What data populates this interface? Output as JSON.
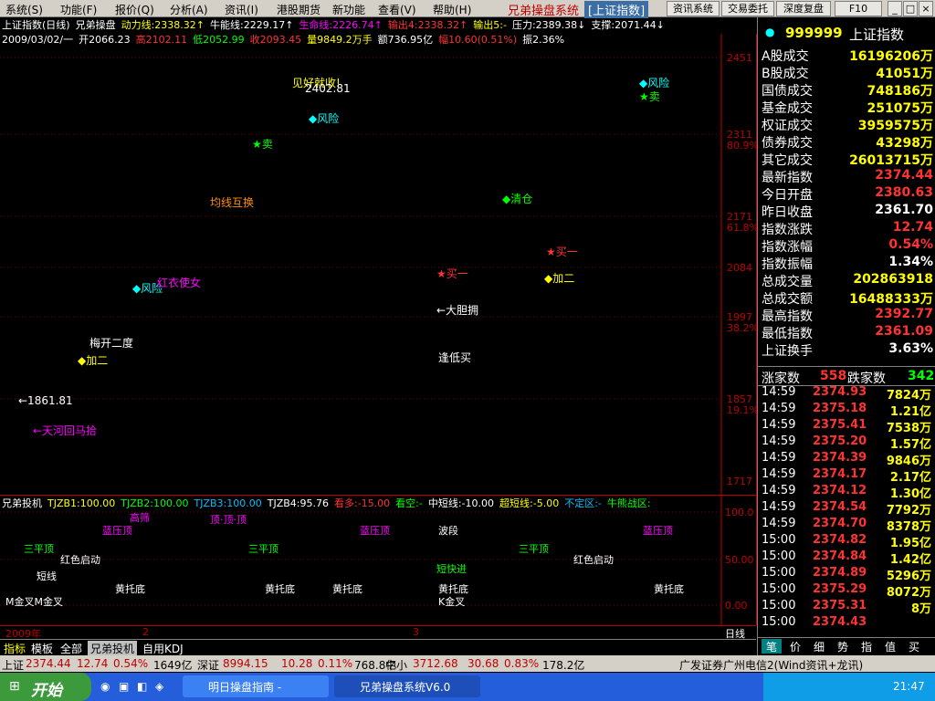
{
  "menu": {
    "items": [
      "系统(S)",
      "功能(F)",
      "报价(Q)",
      "分析(A)",
      "资讯(I)",
      "港股期货",
      "新功能",
      "查看(V)",
      "帮助(H)"
    ],
    "app_title": "兄弟操盘系统",
    "app_subtitle": "[上证指数]",
    "buttons": [
      "资讯系统",
      "交易委托",
      "深度复盘",
      "F10"
    ]
  },
  "chart_header": {
    "line1": [
      {
        "text": "上证指数(日线)",
        "color": "#ffffff"
      },
      {
        "text": "兄弟操盘",
        "color": "#ffffff"
      },
      {
        "text": "动力线:2338.32↑",
        "color": "#ffff00"
      },
      {
        "text": "牛能线:2229.17↑",
        "color": "#ffffff"
      },
      {
        "text": "生命线:2226.74↑",
        "color": "#ff00ff"
      },
      {
        "text": "输出4:2338.32↑",
        "color": "#ff3333"
      },
      {
        "text": "输出5:-",
        "color": "#ffff00"
      },
      {
        "text": "压力:2389.38↓",
        "color": "#ffffff"
      },
      {
        "text": "支撑:2071.44↓",
        "color": "#ffffff"
      }
    ],
    "line2": [
      {
        "text": "2009/03/02/一",
        "color": "#ffffff"
      },
      {
        "text": "开2066.23",
        "color": "#ffffff"
      },
      {
        "text": "高2102.11",
        "color": "#ff3333"
      },
      {
        "text": "低2052.99",
        "color": "#00ff00"
      },
      {
        "text": "收2093.45",
        "color": "#ff3333"
      },
      {
        "text": "量9849.2万手",
        "color": "#ffff00"
      },
      {
        "text": "额736.95亿",
        "color": "#ffffff"
      },
      {
        "text": "幅10.60(0.51%)",
        "color": "#ff3333"
      },
      {
        "text": "振2.36%",
        "color": "#ffffff"
      }
    ]
  },
  "price_axis": [
    "2451",
    "2311",
    "80.9%",
    "2171",
    "61.8%",
    "2084",
    "1997",
    "38.2%",
    "1857",
    "19.1%",
    "1717"
  ],
  "chart_annotations": [
    {
      "text": "见好就收!",
      "color": "#ffff00"
    },
    {
      "text": "2402.81",
      "color": "#ffffff"
    },
    {
      "text": "◆风险",
      "color": "#00ffff"
    },
    {
      "text": "★卖",
      "color": "#00ff00"
    },
    {
      "text": "均线互换",
      "color": "#ff8c00"
    },
    {
      "text": "◆风险",
      "color": "#00ffff"
    },
    {
      "text": "红衣使女",
      "color": "#ff00ff"
    },
    {
      "text": "梅开二度",
      "color": "#ffffff"
    },
    {
      "text": "◆加二",
      "color": "#ffff00"
    },
    {
      "text": "←1861.81",
      "color": "#ffffff"
    },
    {
      "text": "←天河回马拾",
      "color": "#ff00ff"
    },
    {
      "text": "★买一",
      "color": "#ff3333"
    },
    {
      "text": "←大胆拥",
      "color": "#ffffff"
    },
    {
      "text": "逢低买",
      "color": "#ffffff"
    },
    {
      "text": "◆清仓",
      "color": "#00ff00"
    },
    {
      "text": "★买一",
      "color": "#ff3333"
    },
    {
      "text": "◆加二",
      "color": "#ffff00"
    },
    {
      "text": "◆风险",
      "color": "#00ffff"
    },
    {
      "text": "★卖",
      "color": "#00ff00"
    }
  ],
  "osc_header": [
    {
      "text": "兄弟投机",
      "color": "#ffffff"
    },
    {
      "text": "TJZB1:100.00",
      "color": "#ffff00"
    },
    {
      "text": "TJZB2:100.00",
      "color": "#00ff00"
    },
    {
      "text": "TJZB3:100.00",
      "color": "#00bfff"
    },
    {
      "text": "TJZB4:95.76",
      "color": "#ffffff"
    },
    {
      "text": "看多:-15.00",
      "color": "#ff3333"
    },
    {
      "text": "看空:-",
      "color": "#00ff00"
    },
    {
      "text": "中短线:-10.00",
      "color": "#ffffff"
    },
    {
      "text": "超短线:-5.00",
      "color": "#ffff00"
    },
    {
      "text": "不定区:-",
      "color": "#00bfff"
    },
    {
      "text": "牛熊战区:",
      "color": "#00ff00"
    }
  ],
  "osc_axis": [
    "100.0",
    "50.00",
    "0.00"
  ],
  "osc_annotations": [
    {
      "text": "三平顶",
      "color": "#00ff00"
    },
    {
      "text": "红色启动",
      "color": "#ffffff"
    },
    {
      "text": "短线",
      "color": "#ffffff"
    },
    {
      "text": "黄托底",
      "color": "#ffffff"
    },
    {
      "text": "蓝压顶",
      "color": "#ff00ff"
    },
    {
      "text": "高筛",
      "color": "#ff00ff"
    },
    {
      "text": "顶·顶·顶",
      "color": "#ff00ff"
    },
    {
      "text": "三平顶",
      "color": "#00ff00"
    },
    {
      "text": "黄托底",
      "color": "#ffffff"
    },
    {
      "text": "黄托底",
      "color": "#ffffff"
    },
    {
      "text": "蓝压顶",
      "color": "#ff00ff"
    },
    {
      "text": "波段",
      "color": "#ffffff"
    },
    {
      "text": "短快进",
      "color": "#00ff00"
    },
    {
      "text": "黄托底",
      "color": "#ffffff"
    },
    {
      "text": "三平顶",
      "color": "#00ff00"
    },
    {
      "text": "红色启动",
      "color": "#ffffff"
    },
    {
      "text": "黄托底",
      "color": "#ffffff"
    },
    {
      "text": "蓝压顶",
      "color": "#ff00ff"
    },
    {
      "text": "M金叉M金叉",
      "color": "#ffffff"
    },
    {
      "text": "K金叉",
      "color": "#ffffff"
    }
  ],
  "time_axis": [
    "2009年",
    "2",
    "3",
    "日线"
  ],
  "bottom_tabs": [
    "指标",
    "模板",
    "全部",
    "兄弟投机",
    "自用KDJ"
  ],
  "right_panel": {
    "code": "999999",
    "name": "上证指数",
    "rows": [
      {
        "label": "A股成交",
        "value": "16196206万",
        "color": "#ffff00"
      },
      {
        "label": "B股成交",
        "value": "41051万",
        "color": "#ffff00"
      },
      {
        "label": "国债成交",
        "value": "748186万",
        "color": "#ffff00"
      },
      {
        "label": "基金成交",
        "value": "251075万",
        "color": "#ffff00"
      },
      {
        "label": "权证成交",
        "value": "3959575万",
        "color": "#ffff00"
      },
      {
        "label": "债券成交",
        "value": "43298万",
        "color": "#ffff00"
      },
      {
        "label": "其它成交",
        "value": "26013715万",
        "color": "#ffff00"
      },
      {
        "label": "最新指数",
        "value": "2374.44",
        "color": "#ff3333"
      },
      {
        "label": "今日开盘",
        "value": "2380.63",
        "color": "#ff3333"
      },
      {
        "label": "昨日收盘",
        "value": "2361.70",
        "color": "#ffffff"
      },
      {
        "label": "指数涨跌",
        "value": "12.74",
        "color": "#ff3333"
      },
      {
        "label": "指数涨幅",
        "value": "0.54%",
        "color": "#ff3333"
      },
      {
        "label": "指数振幅",
        "value": "1.34%",
        "color": "#ffffff"
      },
      {
        "label": "总成交量",
        "value": "202863918",
        "color": "#ffff00"
      },
      {
        "label": "总成交额",
        "value": "16488333万",
        "color": "#ffff00"
      },
      {
        "label": "最高指数",
        "value": "2392.77",
        "color": "#ff3333"
      },
      {
        "label": "最低指数",
        "value": "2361.09",
        "color": "#ff3333"
      },
      {
        "label": "上证换手",
        "value": "3.63%",
        "color": "#ffffff"
      }
    ],
    "breadth_up_label": "涨家数",
    "breadth_up": "558",
    "breadth_down_label": "跌家数",
    "breadth_down": "342",
    "ticks": [
      {
        "t": "14:59",
        "p": "2374.93",
        "q": "7824万"
      },
      {
        "t": "14:59",
        "p": "2375.18",
        "q": "1.21亿"
      },
      {
        "t": "14:59",
        "p": "2375.41",
        "q": "7538万"
      },
      {
        "t": "14:59",
        "p": "2375.20",
        "q": "1.57亿"
      },
      {
        "t": "14:59",
        "p": "2374.39",
        "q": "9846万"
      },
      {
        "t": "14:59",
        "p": "2374.17",
        "q": "2.17亿"
      },
      {
        "t": "14:59",
        "p": "2374.12",
        "q": "1.30亿"
      },
      {
        "t": "14:59",
        "p": "2374.54",
        "q": "7792万"
      },
      {
        "t": "14:59",
        "p": "2374.70",
        "q": "8378万"
      },
      {
        "t": "15:00",
        "p": "2374.82",
        "q": "1.95亿"
      },
      {
        "t": "15:00",
        "p": "2374.84",
        "q": "1.42亿"
      },
      {
        "t": "15:00",
        "p": "2374.89",
        "q": "5296万"
      },
      {
        "t": "15:00",
        "p": "2375.29",
        "q": "8072万"
      },
      {
        "t": "15:00",
        "p": "2375.31",
        "q": "8万"
      },
      {
        "t": "15:00",
        "p": "2374.43",
        "q": ""
      }
    ],
    "tabs": [
      "笔",
      "价",
      "细",
      "势",
      "指",
      "值",
      "买"
    ]
  },
  "status_bar": {
    "sh_label": "上证",
    "sh_value": "2374.44",
    "sh_chg": "12.74",
    "sh_pct": "0.54%",
    "sh_amount": "1649亿",
    "sz_label": "深证",
    "sz_value": "8994.15",
    "sz_chg": "10.28",
    "sz_pct": "0.11%",
    "sz_amount": "768.8亿",
    "zx_label": "中小",
    "zx_value": "3712.68",
    "zx_chg": "30.68",
    "zx_pct": "0.83%",
    "zx_amount": "178.2亿",
    "broker": "广发证券广州电信2(Wind资讯+龙讯)"
  },
  "taskbar": {
    "start": "开始",
    "windows": [
      "明日操盘指南 -",
      "兄弟操盘系统V6.0"
    ],
    "clock": "21:47"
  }
}
